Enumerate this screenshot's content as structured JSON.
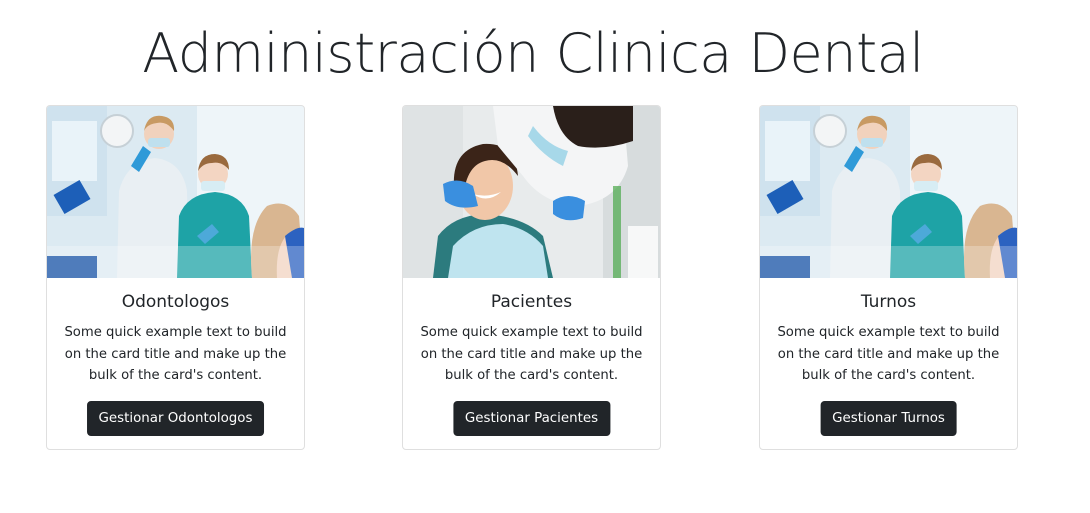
{
  "header": {
    "title": "Administración Clinica Dental"
  },
  "cards": [
    {
      "image": "dental-team-photo",
      "title": "Odontologos",
      "text": "Some quick example text to build on the card title and make up the bulk of the card's content.",
      "button": "Gestionar Odontologos"
    },
    {
      "image": "dentist-patient-photo",
      "title": "Pacientes",
      "text": "Some quick example text to build on the card title and make up the bulk of the card's content.",
      "button": "Gestionar Pacientes"
    },
    {
      "image": "dental-team-photo",
      "title": "Turnos",
      "text": "Some quick example text to build on the card title and make up the bulk of the card's content.",
      "button": "Gestionar Turnos"
    }
  ],
  "colors": {
    "button_bg": "#212529",
    "button_text": "#ffffff",
    "card_border": "#dfdfdf",
    "title_text": "#212529"
  }
}
